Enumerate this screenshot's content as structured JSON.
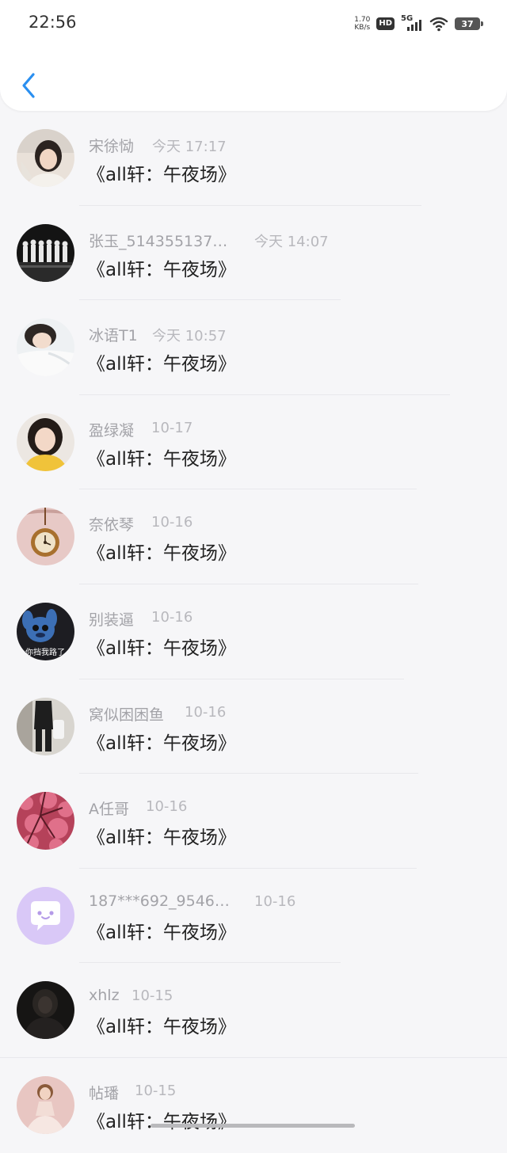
{
  "status_bar": {
    "time": "22:56",
    "net_speed_value": "1.70",
    "net_speed_unit": "KB/s",
    "hd_label": "HD",
    "network_label": "5G",
    "battery_level": "37"
  },
  "header": {
    "back_icon": "chevron-left-icon",
    "accent_color": "#2a8ff0"
  },
  "comments": [
    {
      "name": "宋徐恸",
      "time": "今天 17:17",
      "message": "《all轩：午夜场》",
      "avatar": "photo-portrait-girl"
    },
    {
      "name": "张玉_514355137…",
      "time": "今天 14:07",
      "message": "《all轩：午夜场》",
      "avatar": "photo-group-stage"
    },
    {
      "name": "冰语T1",
      "time": "今天 10:57",
      "message": "《all轩：午夜场》",
      "avatar": "photo-lying-girl"
    },
    {
      "name": "盈绿凝",
      "time": "10-17",
      "message": "《all轩：午夜场》",
      "avatar": "photo-yellow-shirt-girl"
    },
    {
      "name": "奈依琴",
      "time": "10-16",
      "message": "《all轩：午夜场》",
      "avatar": "photo-pocket-watch"
    },
    {
      "name": "别装逼",
      "time": "10-16",
      "message": "《all轩：午夜场》",
      "avatar": "photo-stitch-cartoon",
      "avatar_caption": "你挡我路了"
    },
    {
      "name": "窝似困困鱼",
      "time": "10-16",
      "message": "《all轩：午夜场》",
      "avatar": "photo-fashion-outfit"
    },
    {
      "name": "A任哥",
      "time": "10-16",
      "message": "《all轩：午夜场》",
      "avatar": "photo-red-blossom"
    },
    {
      "name": "187***692_9546…",
      "time": "10-16",
      "message": "《all轩：午夜场》",
      "avatar": "default-chat-bubble-icon"
    },
    {
      "name": "xhlz",
      "time": "10-15",
      "message": "《all轩：午夜场》",
      "avatar": "photo-dark-silhouette"
    },
    {
      "name": "帖璠",
      "time": "10-15",
      "message": "《all轩：午夜场》",
      "avatar": "photo-ballet-figure"
    }
  ]
}
